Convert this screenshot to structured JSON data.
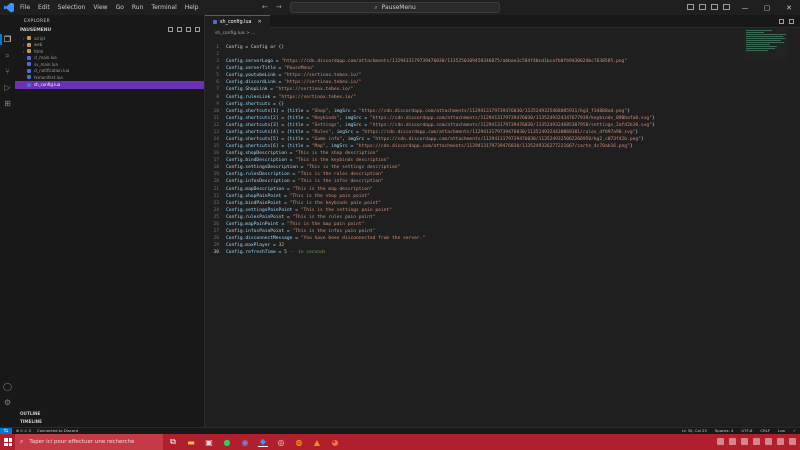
{
  "window": {
    "menu": [
      "File",
      "Edit",
      "Selection",
      "View",
      "Go",
      "Run",
      "Terminal",
      "Help"
    ],
    "command_center": "PauseMenu"
  },
  "sidebar": {
    "title": "EXPLORER",
    "folder": "PAUSEMENU",
    "items": [
      {
        "label": "script",
        "type": "folder",
        "level": 1
      },
      {
        "label": "web",
        "type": "folder",
        "level": 1
      },
      {
        "label": "html",
        "type": "folder",
        "level": 1
      },
      {
        "label": "cl_main.lua",
        "type": "lua",
        "level": 1
      },
      {
        "label": "sv_main.lua",
        "type": "lua",
        "level": 1
      },
      {
        "label": "cl_notification.lua",
        "type": "lua",
        "level": 1
      },
      {
        "label": "fxmanifest.lua",
        "type": "lua",
        "level": 1
      },
      {
        "label": "sh_config.lua",
        "type": "lua",
        "level": 1,
        "selected": true
      }
    ],
    "outline": "OUTLINE",
    "timeline": "TIMELINE"
  },
  "editor": {
    "tab": "sh_config.lua",
    "breadcrumb": "sh_config.lua > ...",
    "current_line": 30,
    "lines": [
      [
        [
          "k",
          "Config = Config or {}"
        ]
      ],
      [
        [
          "k",
          ""
        ]
      ],
      [
        [
          "v",
          "Config.serverLogo = "
        ],
        [
          "s",
          "\"https://cdn.discordapp.com/attachments/1129413179739476030/1135250109458346075/abbae3c584f40cd1bcafb0fb9d30624bc7638585.png\""
        ]
      ],
      [
        [
          "v",
          "Config.serverTitle = "
        ],
        [
          "s",
          "\"PauseMenu\""
        ]
      ],
      [
        [
          "v",
          "Config.youtubeLink = "
        ],
        [
          "s",
          "\"https://sertinox.tebex.io/\""
        ]
      ],
      [
        [
          "v",
          "Config.discordLink = "
        ],
        [
          "s",
          "\"https://sertinox.tebex.io/\""
        ]
      ],
      [
        [
          "v",
          "Config.ShopLink = "
        ],
        [
          "s",
          "\"https://sertinox.tebex.io/\""
        ]
      ],
      [
        [
          "v",
          "Config.rulesLink = "
        ],
        [
          "s",
          "\"https://sertinox.tebex.io/\""
        ]
      ],
      [
        [
          "v",
          "Config.shortcuts = {}"
        ]
      ],
      [
        [
          "v",
          "Config.shortcuts[1] = {title = "
        ],
        [
          "s",
          "\"Shop\""
        ],
        [
          "v",
          ", imgSrc = "
        ],
        [
          "s",
          "\"https://cdn.discordapp.com/attachments/1129413179739476030/1135249325468085931/bg3_f34808ad.png\""
        ],
        [
          "v",
          "}"
        ]
      ],
      [
        [
          "v",
          "Config.shortcuts[2] = {title = "
        ],
        [
          "s",
          "\"Keybinds\""
        ],
        [
          "v",
          ", imgSrc = "
        ],
        [
          "s",
          "\"https://cdn.discordapp.com/attachments/1129413179739476030/1135249324347677939/keybinds_090bafa0.svg\""
        ],
        [
          "v",
          "}"
        ]
      ],
      [
        [
          "v",
          "Config.shortcuts[3] = {title = "
        ],
        [
          "s",
          "\"Settings\""
        ],
        [
          "v",
          ", imgSrc = "
        ],
        [
          "s",
          "\"https://cdn.discordapp.com/attachments/1129413179739476030/1135249324685307958/settings_2afd2b10.svg\""
        ],
        [
          "v",
          "}"
        ]
      ],
      [
        [
          "v",
          "Config.shortcuts[4] = {title = "
        ],
        [
          "s",
          "\"Rules\""
        ],
        [
          "v",
          ", imgSrc = "
        ],
        [
          "s",
          "\"https://cdn.discordapp.com/attachments/1129413179739476030/1135249324430868381/rules_df897a90.svg\""
        ],
        [
          "v",
          "}"
        ]
      ],
      [
        [
          "v",
          "Config.shortcuts[5] = {title = "
        ],
        [
          "s",
          "\"Game info\""
        ],
        [
          "v",
          ", imgSrc = "
        ],
        [
          "s",
          "\"https://cdn.discordapp.com/attachments/1129413179739476030/1135249325062266950/bg2_c073f42b.png\""
        ],
        [
          "v",
          "}"
        ]
      ],
      [
        [
          "v",
          "Config.shortcuts[6] = {title = "
        ],
        [
          "s",
          "\"Map\""
        ],
        [
          "v",
          ", imgSrc = "
        ],
        [
          "s",
          "\"https://cdn.discordapp.com/attachments/1129413179739476030/1135249326277221667/carte_4c70ab16.png\""
        ],
        [
          "v",
          "}"
        ]
      ],
      [
        [
          "v",
          "Config.shopDescription = "
        ],
        [
          "s",
          "\"This is the shop description\""
        ]
      ],
      [
        [
          "v",
          "Config.bindDescription = "
        ],
        [
          "s",
          "\"This is the keybinds description\""
        ]
      ],
      [
        [
          "v",
          "Config.settingsDescription = "
        ],
        [
          "s",
          "\"This is the settings description\""
        ]
      ],
      [
        [
          "v",
          "Config.rulesDescription = "
        ],
        [
          "s",
          "\"This is the rules description\""
        ]
      ],
      [
        [
          "v",
          "Config.infosDescription = "
        ],
        [
          "s",
          "\"This is the infos description\""
        ]
      ],
      [
        [
          "v",
          "Config.mapDescription = "
        ],
        [
          "s",
          "\"This is the map description\""
        ]
      ],
      [
        [
          "v",
          "Config.shopPainPoint = "
        ],
        [
          "s",
          "\"This is the shop pain point\""
        ]
      ],
      [
        [
          "v",
          "Config.bindPainPoint = "
        ],
        [
          "s",
          "\"This is the keybinds pain point\""
        ]
      ],
      [
        [
          "v",
          "Config.settingsPainPoint = "
        ],
        [
          "s",
          "\"This is the settings pain point\""
        ]
      ],
      [
        [
          "v",
          "Config.rulesPainPoint = "
        ],
        [
          "s",
          "\"This is the rules pain point\""
        ]
      ],
      [
        [
          "v",
          "Config.mapPainPoint = "
        ],
        [
          "s",
          "\"This is the map pain point\""
        ]
      ],
      [
        [
          "v",
          "Config.infosPainPoint = "
        ],
        [
          "s",
          "\"This is the infos pain point\""
        ]
      ],
      [
        [
          "v",
          "Config.disconnectMessage = "
        ],
        [
          "s",
          "\"You have been disconnected from the server.\""
        ]
      ],
      [
        [
          "v",
          "Config.maxPlayer = "
        ],
        [
          "n",
          "32"
        ]
      ],
      [
        [
          "v",
          "Config.refreshTime = "
        ],
        [
          "n",
          "5"
        ],
        [
          "c",
          " -- in seconds"
        ]
      ]
    ]
  },
  "statusbar": {
    "left": [
      "⊗ 0 ⚠ 0",
      "Connected to Discord"
    ],
    "right": [
      "Ln 30, Col 25",
      "Spaces: 4",
      "UTF-8",
      "CRLF",
      "Lua",
      "✓"
    ]
  },
  "taskbar": {
    "search_placeholder": "Taper ici pour effectuer une recherche"
  },
  "colors": {
    "accent": "#0078d4",
    "selection": "#6c2fb8",
    "taskbar": "#b0202c",
    "string": "#ce9178",
    "variable": "#9cdcfe"
  }
}
